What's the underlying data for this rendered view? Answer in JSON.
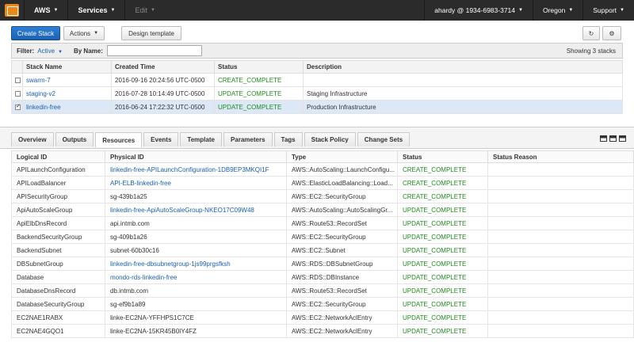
{
  "topbar": {
    "brand": "AWS",
    "services": "Services",
    "edit": "Edit",
    "account": "ahardy @ 1934-6983-3714",
    "region": "Oregon",
    "support": "Support"
  },
  "toolbar": {
    "create_stack": "Create Stack",
    "actions": "Actions",
    "design_template": "Design template",
    "refresh_icon": "refresh-icon",
    "settings_icon": "gear-icon"
  },
  "filter": {
    "label": "Filter:",
    "value": "Active",
    "by_name_label": "By Name:",
    "by_name_value": "",
    "showing": "Showing 3 stacks"
  },
  "stacks": {
    "headers": [
      "Stack Name",
      "Created Time",
      "Status",
      "Description"
    ],
    "rows": [
      {
        "name": "swarm-7",
        "created": "2016-09-16 20:24:56 UTC-0500",
        "status": "CREATE_COMPLETE",
        "description": ""
      },
      {
        "name": "staging-v2",
        "created": "2016-07-28 10:14:49 UTC-0500",
        "status": "UPDATE_COMPLETE",
        "description": "Staging Infrastructure"
      },
      {
        "name": "linkedin-free",
        "created": "2016-06-24 17:22:32 UTC-0500",
        "status": "UPDATE_COMPLETE",
        "description": "Production Infrastructure"
      }
    ]
  },
  "tabs": [
    "Overview",
    "Outputs",
    "Resources",
    "Events",
    "Template",
    "Parameters",
    "Tags",
    "Stack Policy",
    "Change Sets"
  ],
  "resources": {
    "headers": [
      "Logical ID",
      "Physical ID",
      "Type",
      "Status",
      "Status Reason"
    ],
    "rows": [
      {
        "logical": "APILaunchConfiguration",
        "physical": "linkedin-free-APILaunchConfiguration-1DB9EP3MKQI1F",
        "type": "AWS::AutoScaling::LaunchConfigu...",
        "status": "CREATE_COMPLETE",
        "reason": ""
      },
      {
        "logical": "APILoadBalancer",
        "physical": "API-ELB-linkedin-free",
        "type": "AWS::ElasticLoadBalancing::Load...",
        "status": "CREATE_COMPLETE",
        "reason": ""
      },
      {
        "logical": "APISecurityGroup",
        "physical": "sg-439b1a25",
        "type": "AWS::EC2::SecurityGroup",
        "status": "CREATE_COMPLETE",
        "reason": ""
      },
      {
        "logical": "ApiAutoScaleGroup",
        "physical": "linkedin-free-ApiAutoScaleGroup-NKEO17C09W48",
        "type": "AWS::AutoScaling::AutoScalingGr...",
        "status": "UPDATE_COMPLETE",
        "reason": ""
      },
      {
        "logical": "ApiElbDnsRecord",
        "physical": "api.intmb.com",
        "type": "AWS::Route53::RecordSet",
        "status": "UPDATE_COMPLETE",
        "reason": ""
      },
      {
        "logical": "BackendSecurityGroup",
        "physical": "sg-409b1a26",
        "type": "AWS::EC2::SecurityGroup",
        "status": "UPDATE_COMPLETE",
        "reason": ""
      },
      {
        "logical": "BackendSubnet",
        "physical": "subnet-60b30c16",
        "type": "AWS::EC2::Subnet",
        "status": "UPDATE_COMPLETE",
        "reason": ""
      },
      {
        "logical": "DBSubnetGroup",
        "physical": "linkedin-free-dbsubnetgroup-1js99prgsfksh",
        "type": "AWS::RDS::DBSubnetGroup",
        "status": "UPDATE_COMPLETE",
        "reason": ""
      },
      {
        "logical": "Database",
        "physical": "mondo-rds-linkedin-free",
        "type": "AWS::RDS::DBInstance",
        "status": "UPDATE_COMPLETE",
        "reason": ""
      },
      {
        "logical": "DatabaseDnsRecord",
        "physical": "db.intmb.com",
        "type": "AWS::Route53::RecordSet",
        "status": "UPDATE_COMPLETE",
        "reason": ""
      },
      {
        "logical": "DatabaseSecurityGroup",
        "physical": "sg-ef9b1a89",
        "type": "AWS::EC2::SecurityGroup",
        "status": "UPDATE_COMPLETE",
        "reason": ""
      },
      {
        "logical": "EC2NAE1RABX",
        "physical": "linke-EC2NA-YFFHPS1C7CE",
        "type": "AWS::EC2::NetworkAclEntry",
        "status": "UPDATE_COMPLETE",
        "reason": ""
      },
      {
        "logical": "EC2NAE4GQO1",
        "physical": "linke-EC2NA-15KR45B0IY4FZ",
        "type": "AWS::EC2::NetworkAclEntry",
        "status": "UPDATE_COMPLETE",
        "reason": ""
      }
    ]
  },
  "colors": {
    "accent": "#1d5fb0",
    "status_green": "#1e8a1e",
    "navbar": "#2b2b2b",
    "aws_orange": "#e8891a"
  }
}
